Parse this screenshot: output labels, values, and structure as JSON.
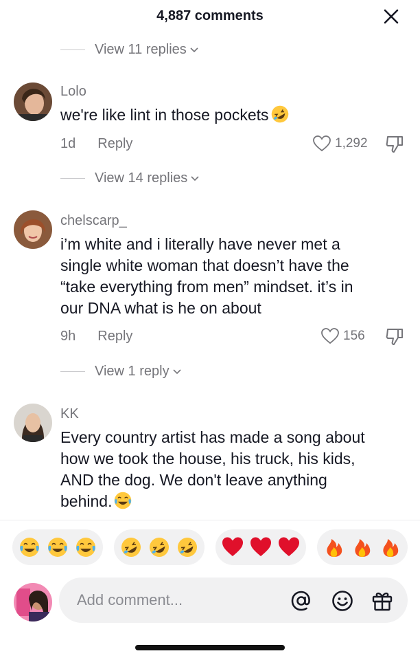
{
  "header": {
    "title": "4,887 comments",
    "close_icon": "close-icon"
  },
  "thread": [
    {
      "view_replies": "View 11 replies"
    },
    {
      "username": "Lolo",
      "text": "we're like lint in those pockets",
      "inline_emoji": "rolling-on-floor-laughing",
      "time": "1d",
      "reply_label": "Reply",
      "likes": "1,292"
    },
    {
      "view_replies": "View 14 replies"
    },
    {
      "username": "chelscarp_",
      "text_lines": [
        "i’m white and i literally have never met a",
        "single white woman that doesn’t have the",
        "“take everything from men” mindset. it’s in",
        "our DNA what is he on about"
      ],
      "time": "9h",
      "reply_label": "Reply",
      "likes": "156"
    },
    {
      "view_replies": "View 1 reply"
    },
    {
      "username": "KK",
      "text_lines": [
        "Every country artist has made a song about",
        "how we took the house, his truck, his kids,",
        "AND the dog. We don't leave anything",
        "behind."
      ],
      "inline_emoji": "face-with-tears-of-joy"
    }
  ],
  "reactions": [
    {
      "emoji": "face-with-tears-of-joy",
      "count": 3
    },
    {
      "emoji": "rolling-on-floor-laughing",
      "count": 3
    },
    {
      "emoji": "red-heart",
      "count": 3
    },
    {
      "emoji": "fire",
      "count": 3
    }
  ],
  "composer": {
    "placeholder": "Add comment...",
    "icons": [
      "at-mention-icon",
      "emoji-icon",
      "gift-icon"
    ]
  },
  "colors": {
    "text": "#161823",
    "muted": "#75757a",
    "pill_bg": "#f1f1f2",
    "heart": "#e0102b"
  }
}
